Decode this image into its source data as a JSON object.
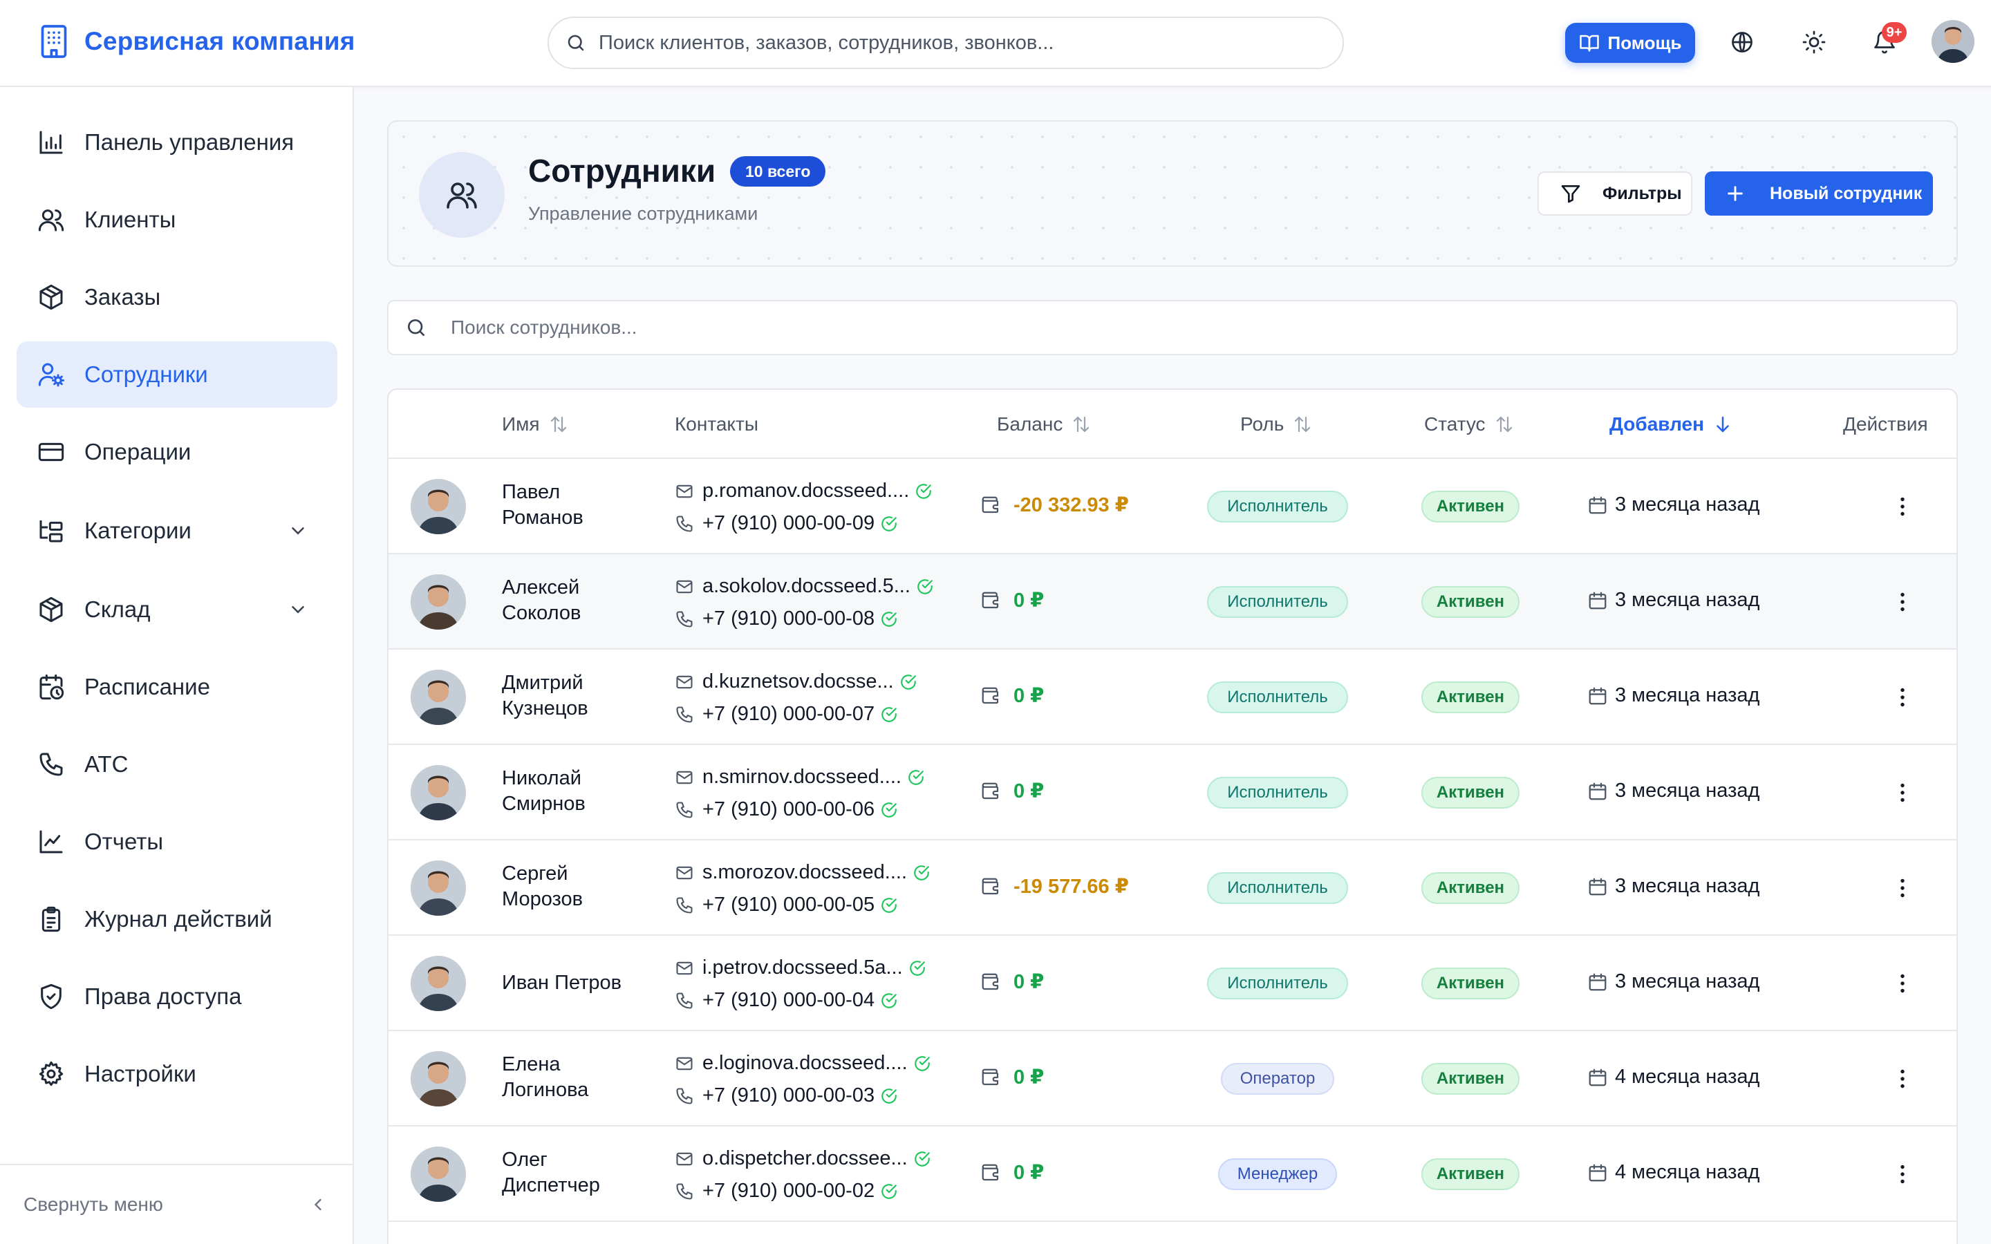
{
  "app": {
    "brand_name": "Сервисная компания",
    "brand_icon": "building-icon",
    "search_placeholder": "Поиск клиентов, заказов, сотрудников, звонков...",
    "help_label": "Помощь",
    "notifications_badge": "9+",
    "accent_color": "#2563eb"
  },
  "sidebar": {
    "items": [
      {
        "label": "Панель управления",
        "icon": "bar-chart-icon"
      },
      {
        "label": "Клиенты",
        "icon": "users-icon"
      },
      {
        "label": "Заказы",
        "icon": "package-icon"
      },
      {
        "label": "Сотрудники",
        "icon": "user-cog-icon",
        "active": true
      },
      {
        "label": "Операции",
        "icon": "credit-card-icon"
      },
      {
        "label": "Категории",
        "icon": "folder-tree-icon",
        "expandable": true
      },
      {
        "label": "Склад",
        "icon": "package-icon",
        "expandable": true
      },
      {
        "label": "Расписание",
        "icon": "calendar-clock-icon"
      },
      {
        "label": "АТС",
        "icon": "phone-icon"
      },
      {
        "label": "Отчеты",
        "icon": "line-chart-icon"
      },
      {
        "label": "Журнал действий",
        "icon": "clipboard-list-icon"
      },
      {
        "label": "Права доступа",
        "icon": "shield-check-icon"
      },
      {
        "label": "Настройки",
        "icon": "gear-icon"
      }
    ],
    "collapse_label": "Свернуть меню"
  },
  "page": {
    "title": "Сотрудники",
    "count_badge": "10 всего",
    "subtitle": "Управление сотрудниками",
    "filters_label": "Фильтры",
    "new_button_label": "Новый сотрудник",
    "table_search_placeholder": "Поиск сотрудников..."
  },
  "table": {
    "columns": {
      "name": "Имя",
      "contacts": "Контакты",
      "balance": "Баланс",
      "role": "Роль",
      "status": "Статус",
      "added": "Добавлен",
      "actions": "Действия"
    },
    "sorted_column": "added",
    "rows": [
      {
        "first": "Павел",
        "last": "Романов",
        "email": "p.romanov.docsseed....",
        "phone": "+7 (910) 000-00-09",
        "balance": "-20 332.93 ₽",
        "balance_kind": "neg",
        "role": "Исполнитель",
        "role_kind": "executor",
        "status": "Активен",
        "added": "3 месяца назад",
        "avatar_color": "#33404f"
      },
      {
        "first": "Алексей",
        "last": "Соколов",
        "email": "a.sokolov.docsseed.5...",
        "phone": "+7 (910) 000-00-08",
        "balance": "0 ₽",
        "balance_kind": "zero",
        "role": "Исполнитель",
        "role_kind": "executor",
        "status": "Активен",
        "added": "3 месяца назад",
        "avatar_color": "#4a3a30"
      },
      {
        "first": "Дмитрий",
        "last": "Кузнецов",
        "email": "d.kuznetsov.docsse...",
        "phone": "+7 (910) 000-00-07",
        "balance": "0 ₽",
        "balance_kind": "zero",
        "role": "Исполнитель",
        "role_kind": "executor",
        "status": "Активен",
        "added": "3 месяца назад",
        "avatar_color": "#3a4652"
      },
      {
        "first": "Николай",
        "last": "Смирнов",
        "email": "n.smirnov.docsseed....",
        "phone": "+7 (910) 000-00-06",
        "balance": "0 ₽",
        "balance_kind": "zero",
        "role": "Исполнитель",
        "role_kind": "executor",
        "status": "Активен",
        "added": "3 месяца назад",
        "avatar_color": "#2f3a4a"
      },
      {
        "first": "Сергей",
        "last": "Морозов",
        "email": "s.morozov.docsseed....",
        "phone": "+7 (910) 000-00-05",
        "balance": "-19 577.66 ₽",
        "balance_kind": "neg",
        "role": "Исполнитель",
        "role_kind": "executor",
        "status": "Активен",
        "added": "3 месяца назад",
        "avatar_color": "#3b4756"
      },
      {
        "first": "Иван Петров",
        "last": "",
        "email": "i.petrov.docsseed.5a...",
        "phone": "+7 (910) 000-00-04",
        "balance": "0 ₽",
        "balance_kind": "zero",
        "role": "Исполнитель",
        "role_kind": "executor",
        "status": "Активен",
        "added": "3 месяца назад",
        "avatar_color": "#34414f"
      },
      {
        "first": "Елена",
        "last": "Логинова",
        "email": "e.loginova.docsseed....",
        "phone": "+7 (910) 000-00-03",
        "balance": "0 ₽",
        "balance_kind": "zero",
        "role": "Оператор",
        "role_kind": "operator",
        "status": "Активен",
        "added": "4 месяца назад",
        "avatar_color": "#5a4638"
      },
      {
        "first": "Олег",
        "last": "Диспетчер",
        "email": "o.dispetcher.docssee...",
        "phone": "+7 (910) 000-00-02",
        "balance": "0 ₽",
        "balance_kind": "zero",
        "role": "Менеджер",
        "role_kind": "manager",
        "status": "Активен",
        "added": "4 месяца назад",
        "avatar_color": "#2e3b4b"
      }
    ]
  }
}
